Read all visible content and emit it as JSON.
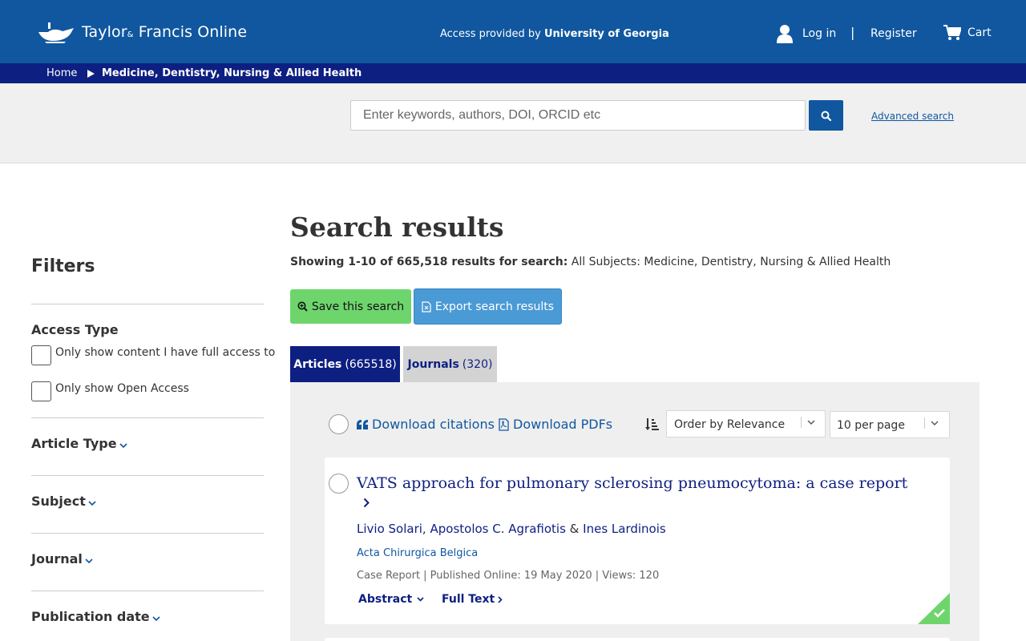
{
  "header": {
    "logo_text_1": "Taylor",
    "logo_amp": "&",
    "logo_text_2": "Francis Online",
    "access_prefix": "Access provided by",
    "access_institution": "University of Georgia",
    "login_label": "Log in",
    "separator": "|",
    "register_label": "Register",
    "cart_label": "Cart",
    "brand_color": "#10579f"
  },
  "breadcrumb": {
    "home": "Home",
    "current": "Medicine, Dentistry, Nursing & Allied Health"
  },
  "search": {
    "placeholder": "Enter keywords, authors, DOI, ORCID etc",
    "advanced_label": "Advanced search"
  },
  "filters": {
    "title": "Filters",
    "access_type_title": "Access Type",
    "access_options": [
      {
        "label": "Only show content I have full access to",
        "checked": false
      },
      {
        "label": "Only show Open Access",
        "checked": false
      }
    ],
    "sections": [
      "Article Type",
      "Subject",
      "Journal",
      "Publication date"
    ]
  },
  "main": {
    "title": "Search results",
    "showing_bold": "Showing 1-10 of 665,518 results for search:",
    "showing_query": "All Subjects: Medicine, Dentistry, Nursing & Allied Health",
    "save_search_label": "Save this search",
    "export_label": "Export search results",
    "tabs": [
      {
        "label": "Articles",
        "count": "(665518)",
        "active": true
      },
      {
        "label": "Journals",
        "count": "(320)",
        "active": false
      }
    ],
    "toolbar": {
      "download_citations": "Download citations",
      "download_pdfs": "Download PDFs",
      "order_by": "Order by Relevance",
      "per_page": "10 per page"
    },
    "results": [
      {
        "title": "VATS approach for pulmonary sclerosing pneumocytoma: a case report",
        "author_1": "Livio Solari",
        "author_sep": ",",
        "author_2": "Apostolos C. Agrafiotis",
        "author_amp": "&",
        "author_3": "Ines Lardinois",
        "journal": "Acta Chirurgica Belgica",
        "meta": "Case Report | Published Online: 19 May 2020 | Views: 120",
        "abstract_label": "Abstract",
        "fulltext_label": "Full Text",
        "access_icon": "check-corner-icon"
      }
    ]
  }
}
